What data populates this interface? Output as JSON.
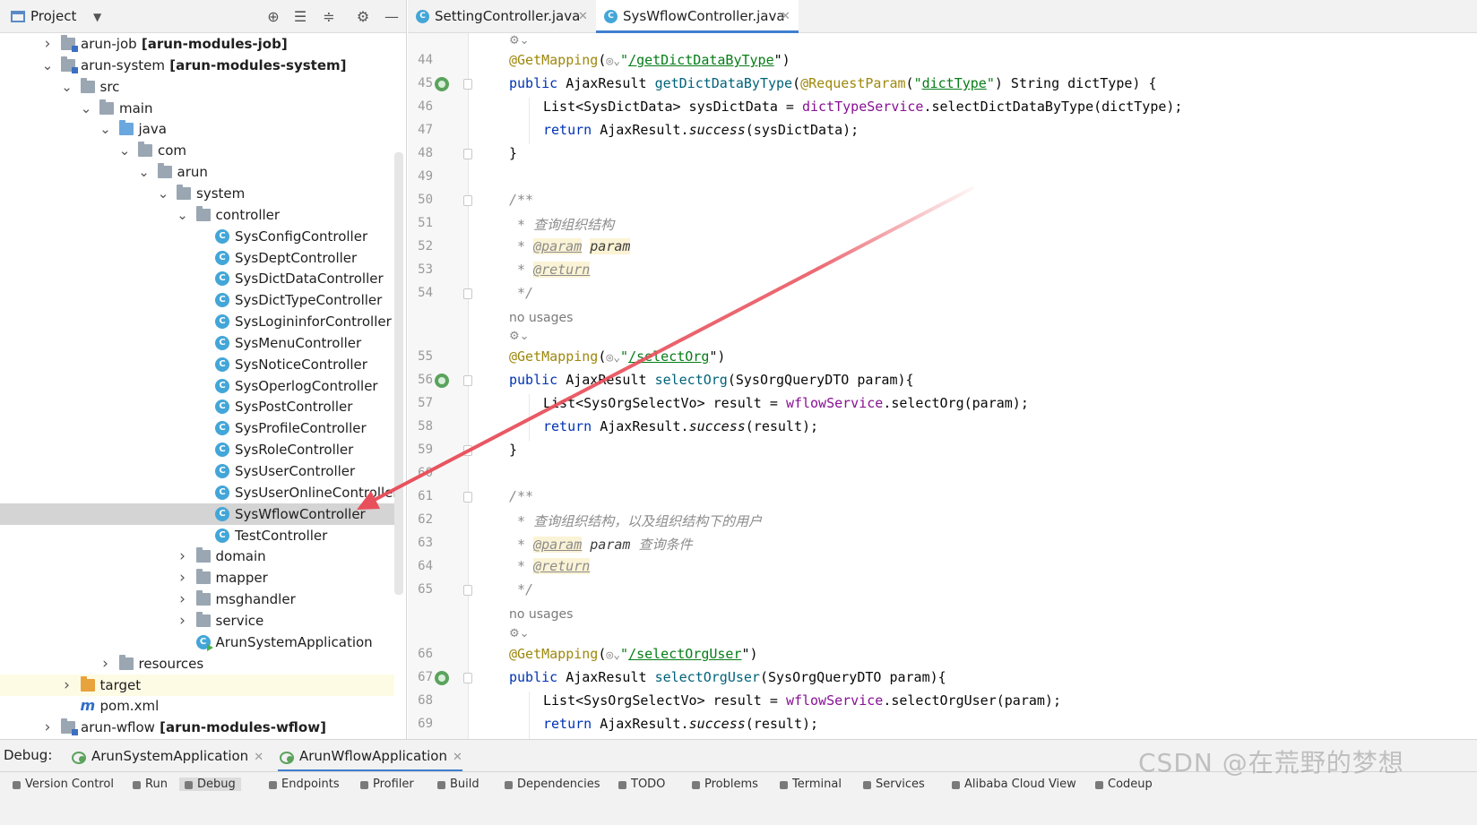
{
  "project_panel": {
    "title": "Project",
    "toolbar_icons": [
      "locate-icon",
      "expand-all-icon",
      "collapse-all-icon",
      "gear-icon",
      "minimize-icon"
    ],
    "tree": [
      {
        "name": "arun-job",
        "suffix": "[arun-modules-job]",
        "kind": "module",
        "depth": 0,
        "expanded": false
      },
      {
        "name": "arun-system",
        "suffix": "[arun-modules-system]",
        "kind": "module",
        "depth": 0,
        "expanded": true
      },
      {
        "name": "src",
        "kind": "folder",
        "depth": 1,
        "expanded": true
      },
      {
        "name": "main",
        "kind": "folder",
        "depth": 2,
        "expanded": true
      },
      {
        "name": "java",
        "kind": "folder-blue",
        "depth": 3,
        "expanded": true
      },
      {
        "name": "com",
        "kind": "folder",
        "depth": 4,
        "expanded": true
      },
      {
        "name": "arun",
        "kind": "folder",
        "depth": 5,
        "expanded": true
      },
      {
        "name": "system",
        "kind": "folder",
        "depth": 6,
        "expanded": true
      },
      {
        "name": "controller",
        "kind": "folder",
        "depth": 7,
        "expanded": true
      },
      {
        "name": "SysConfigController",
        "kind": "class",
        "depth": 8
      },
      {
        "name": "SysDeptController",
        "kind": "class",
        "depth": 8
      },
      {
        "name": "SysDictDataController",
        "kind": "class",
        "depth": 8
      },
      {
        "name": "SysDictTypeController",
        "kind": "class",
        "depth": 8
      },
      {
        "name": "SysLogininforController",
        "kind": "class",
        "depth": 8
      },
      {
        "name": "SysMenuController",
        "kind": "class",
        "depth": 8
      },
      {
        "name": "SysNoticeController",
        "kind": "class",
        "depth": 8
      },
      {
        "name": "SysOperlogController",
        "kind": "class",
        "depth": 8
      },
      {
        "name": "SysPostController",
        "kind": "class",
        "depth": 8
      },
      {
        "name": "SysProfileController",
        "kind": "class",
        "depth": 8
      },
      {
        "name": "SysRoleController",
        "kind": "class",
        "depth": 8
      },
      {
        "name": "SysUserController",
        "kind": "class",
        "depth": 8
      },
      {
        "name": "SysUserOnlineController",
        "kind": "class",
        "depth": 8
      },
      {
        "name": "SysWflowController",
        "kind": "class",
        "depth": 8,
        "selected": true
      },
      {
        "name": "TestController",
        "kind": "class",
        "depth": 8
      },
      {
        "name": "domain",
        "kind": "folder",
        "depth": 7,
        "expanded": false
      },
      {
        "name": "mapper",
        "kind": "folder",
        "depth": 7,
        "expanded": false
      },
      {
        "name": "msghandler",
        "kind": "folder",
        "depth": 7,
        "expanded": false
      },
      {
        "name": "service",
        "kind": "folder",
        "depth": 7,
        "expanded": false
      },
      {
        "name": "ArunSystemApplication",
        "kind": "app",
        "depth": 7
      },
      {
        "name": "resources",
        "kind": "folder-res",
        "depth": 3,
        "expanded": false
      },
      {
        "name": "target",
        "kind": "folder-orange",
        "depth": 1,
        "expanded": false,
        "highlight": true
      },
      {
        "name": "pom.xml",
        "kind": "maven",
        "depth": 1
      },
      {
        "name": "arun-wflow",
        "suffix": "[arun-modules-wflow]",
        "kind": "module",
        "depth": 0,
        "expanded": false
      }
    ]
  },
  "editor_tabs": [
    {
      "label": "SettingController.java",
      "active": false
    },
    {
      "label": "SysWflowController.java",
      "active": true
    }
  ],
  "code_lines": [
    {
      "ln": "44",
      "text": "@GetMapping(\"/getDictDataByType\")"
    },
    {
      "ln": "45",
      "text": "public AjaxResult getDictDataByType(@RequestParam(\"dictType\") String dictType) {"
    },
    {
      "ln": "46",
      "text": "List<SysDictData> sysDictData = dictTypeService.selectDictDataByType(dictType);"
    },
    {
      "ln": "47",
      "text": "return AjaxResult.success(sysDictData);"
    },
    {
      "ln": "48",
      "text": "}"
    },
    {
      "ln": "49",
      "text": ""
    },
    {
      "ln": "50",
      "text": "/**"
    },
    {
      "ln": "51",
      "text": "* 查询组织结构"
    },
    {
      "ln": "52",
      "text": "* @param param"
    },
    {
      "ln": "53",
      "text": "* @return"
    },
    {
      "ln": "54",
      "text": "*/"
    },
    {
      "ln": "55",
      "text": "@GetMapping(\"/selectOrg\")"
    },
    {
      "ln": "56",
      "text": "public AjaxResult selectOrg(SysOrgQueryDTO param){"
    },
    {
      "ln": "57",
      "text": "List<SysOrgSelectVo> result = wflowService.selectOrg(param);"
    },
    {
      "ln": "58",
      "text": "return AjaxResult.success(result);"
    },
    {
      "ln": "59",
      "text": "}"
    },
    {
      "ln": "60",
      "text": ""
    },
    {
      "ln": "61",
      "text": "/**"
    },
    {
      "ln": "62",
      "text": "* 查询组织结构，以及组织结构下的用户"
    },
    {
      "ln": "63",
      "text": "* @param param 查询条件"
    },
    {
      "ln": "64",
      "text": "* @return"
    },
    {
      "ln": "65",
      "text": "*/"
    },
    {
      "ln": "66",
      "text": "@GetMapping(\"/selectOrgUser\")"
    },
    {
      "ln": "67",
      "text": "public AjaxResult selectOrgUser(SysOrgQueryDTO param){"
    },
    {
      "ln": "68",
      "text": "List<SysOrgSelectVo> result = wflowService.selectOrgUser(param);"
    },
    {
      "ln": "69",
      "text": "return AjaxResult.success(result);"
    }
  ],
  "code_tokens": {
    "get_mapping": "@GetMapping",
    "open_paren": "(",
    "quote": "\"",
    "path_dict": "/getDictDataByType",
    "path_org": "/selectOrg",
    "path_org_user": "/selectOrgUser",
    "close_paren": "\")",
    "public": "public",
    "ajax_result": "AjaxResult",
    "fn_dict": "getDictDataByType",
    "request_param": "@RequestParam",
    "dict_type_lit": "dictType",
    "dict_type_rest": ") String dictType) {",
    "list_dict": "List<SysDictData> sysDictData = ",
    "dict_service": "dictTypeService",
    "select_dict_call": ".selectDictDataByType(dictType);",
    "return": "return",
    "ajax_result_dot": "AjaxResult.",
    "success": "success",
    "arg_dict": "(sysDictData);",
    "close_brace": "}",
    "doc_open": "/**",
    "doc_star": "* ",
    "doc_close": "*/",
    "cmt_org": "查询组织结构",
    "cmt_org_user": "查询组织结构，以及组织结构下的用户",
    "tag_param": "@param",
    "tag_return": "@return",
    "param_name": "param",
    "param_desc": "查询条件",
    "fn_org": "selectOrg",
    "fn_org_user": "selectOrgUser",
    "org_sig": "(SysOrgQueryDTO param){",
    "list_org": "List<SysOrgSelectVo> result = ",
    "wflow_service": "wflowService",
    "select_org_call": ".selectOrg(param);",
    "select_org_user_call": ".selectOrgUser(param);",
    "arg_result": "(result);",
    "space": " "
  },
  "inlay_hints": {
    "no_usages": "no usages"
  },
  "debug_bar": {
    "label": "Debug:",
    "tabs": [
      {
        "label": "ArunSystemApplication",
        "active": false
      },
      {
        "label": "ArunWflowApplication",
        "active": true
      }
    ]
  },
  "tool_strip": [
    "Version Control",
    "Run",
    "Debug",
    "Endpoints",
    "Profiler",
    "Build",
    "Dependencies",
    "TODO",
    "Problems",
    "Terminal",
    "Services",
    "Alibaba Cloud View",
    "Codeup"
  ],
  "watermark": "CSDN @在荒野的梦想",
  "colors": {
    "accent": "#3f7fd0",
    "arrow": "#e8505b",
    "selection": "#d4d4d4"
  }
}
